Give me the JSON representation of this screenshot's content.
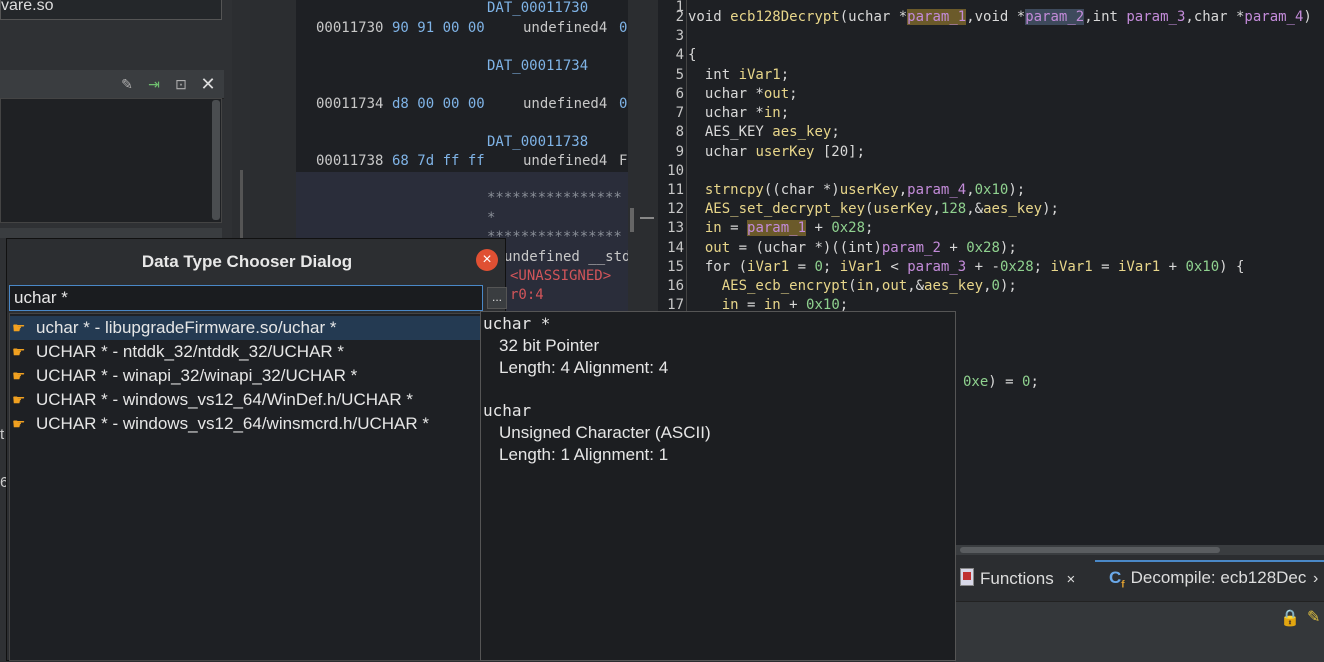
{
  "left": {
    "file_name": "vare.so",
    "edge_text_1": "t",
    "edge_text_2": "6"
  },
  "listing": {
    "rows": [
      {
        "label": "DAT_00011730",
        "addr": "00011730",
        "bytes": "90 91 00 00",
        "type": "undefined4",
        "trail": "0"
      },
      {
        "label": "DAT_00011734",
        "addr": "00011734",
        "bytes": "d8 00 00 00",
        "type": "undefined4",
        "trail": "0"
      },
      {
        "label": "DAT_00011738",
        "addr": "00011738",
        "bytes": "68 7d ff ff",
        "type": "undefined4",
        "trail": "F"
      }
    ],
    "stars_1": "****************",
    "star_single": "*",
    "stars_2": "****************",
    "undefined_stdcall": "undefined __stdca",
    "unassigned": "<UNASSIGNED>",
    "r0": "r0:4"
  },
  "decompiler": {
    "lines": [
      "1",
      "2",
      "3",
      "4",
      "5",
      "6",
      "7",
      "8",
      "9",
      "10",
      "11",
      "12",
      "13",
      "14",
      "15",
      "16",
      "17"
    ],
    "code_2": {
      "pre": "void ",
      "fn": "ecb128Decrypt",
      "a": "(uchar *",
      "p1": "param_1",
      "b": ",void *",
      "p2": "param_2",
      "c": ",int ",
      "p3": "param_3",
      "d": ",char *",
      "p4": "param_4",
      "e": ")"
    },
    "code_4": "{",
    "code_5": {
      "t": "  int ",
      "v": "iVar1",
      "e": ";"
    },
    "code_6": {
      "t": "  uchar *",
      "v": "out",
      "e": ";"
    },
    "code_7": {
      "t": "  uchar *",
      "v": "in",
      "e": ";"
    },
    "code_8": {
      "t": "  AES_KEY ",
      "v": "aes_key",
      "e": ";"
    },
    "code_9": {
      "t": "  uchar ",
      "v": "userKey",
      "e": " [20];"
    },
    "code_11": {
      "fn": "  strncpy",
      "a": "((char *)",
      "v": "userKey",
      "b": ",",
      "p": "param_4",
      "c": ",",
      "n": "0x10",
      "e": ");"
    },
    "code_12": {
      "fn": "  AES_set_decrypt_key",
      "a": "(",
      "v": "userKey",
      "b": ",",
      "n": "128",
      "c": ",&",
      "k": "aes_key",
      "e": ");"
    },
    "code_13": {
      "v": "  in",
      "a": " = ",
      "p": "param_1",
      "b": " + ",
      "n": "0x28",
      "e": ";"
    },
    "code_14": {
      "v": "  out",
      "a": " = (uchar *)((int)",
      "p": "param_2",
      "b": " + ",
      "n": "0x28",
      "e": ");"
    },
    "code_15": {
      "a": "  for (",
      "v1": "iVar1",
      "b": " = ",
      "n1": "0",
      "c": "; ",
      "v2": "iVar1",
      "d": " < ",
      "p": "param_3",
      "e": " + -",
      "n2": "0x28",
      "f": "; ",
      "v3": "iVar1",
      "g": " = ",
      "v4": "iVar1",
      "h": " + ",
      "n3": "0x10",
      "i": ") {"
    },
    "code_16": {
      "fn": "    AES_ecb_encrypt",
      "a": "(",
      "v1": "in",
      "b": ",",
      "v2": "out",
      "c": ",&",
      "k": "aes_key",
      "d": ",",
      "n": "0",
      "e": ");"
    },
    "code_17": {
      "v": "    in",
      "a": " = ",
      "v2": "in",
      "b": " + ",
      "n": "0x10",
      "e": ";"
    },
    "code_partial": {
      "n": "0xe",
      "a": ") = ",
      "n2": "0",
      "e": ";"
    }
  },
  "tabs": {
    "functions": "Functions",
    "functions_close": "×",
    "decompile": "Decompile: ecb128Dec"
  },
  "dialog": {
    "title": "Data Type Chooser Dialog",
    "input_value": "uchar *",
    "browse_label": "...",
    "items": [
      "uchar * - libupgradeFirmware.so/uchar *",
      "UCHAR * - ntddk_32/ntddk_32/UCHAR *",
      "UCHAR * - winapi_32/winapi_32/UCHAR *",
      "UCHAR * - windows_vs12_64/WinDef.h/UCHAR *",
      "UCHAR * - windows_vs12_64/winsmcrd.h/UCHAR *"
    ],
    "selected_index": 0
  },
  "preview": {
    "name1": "uchar *",
    "desc1": "32 bit  Pointer",
    "len1": "Length: 4  Alignment: 4",
    "name2": "uchar",
    "desc2": "Unsigned Character (ASCII)",
    "len2": "Length: 1  Alignment: 1"
  }
}
